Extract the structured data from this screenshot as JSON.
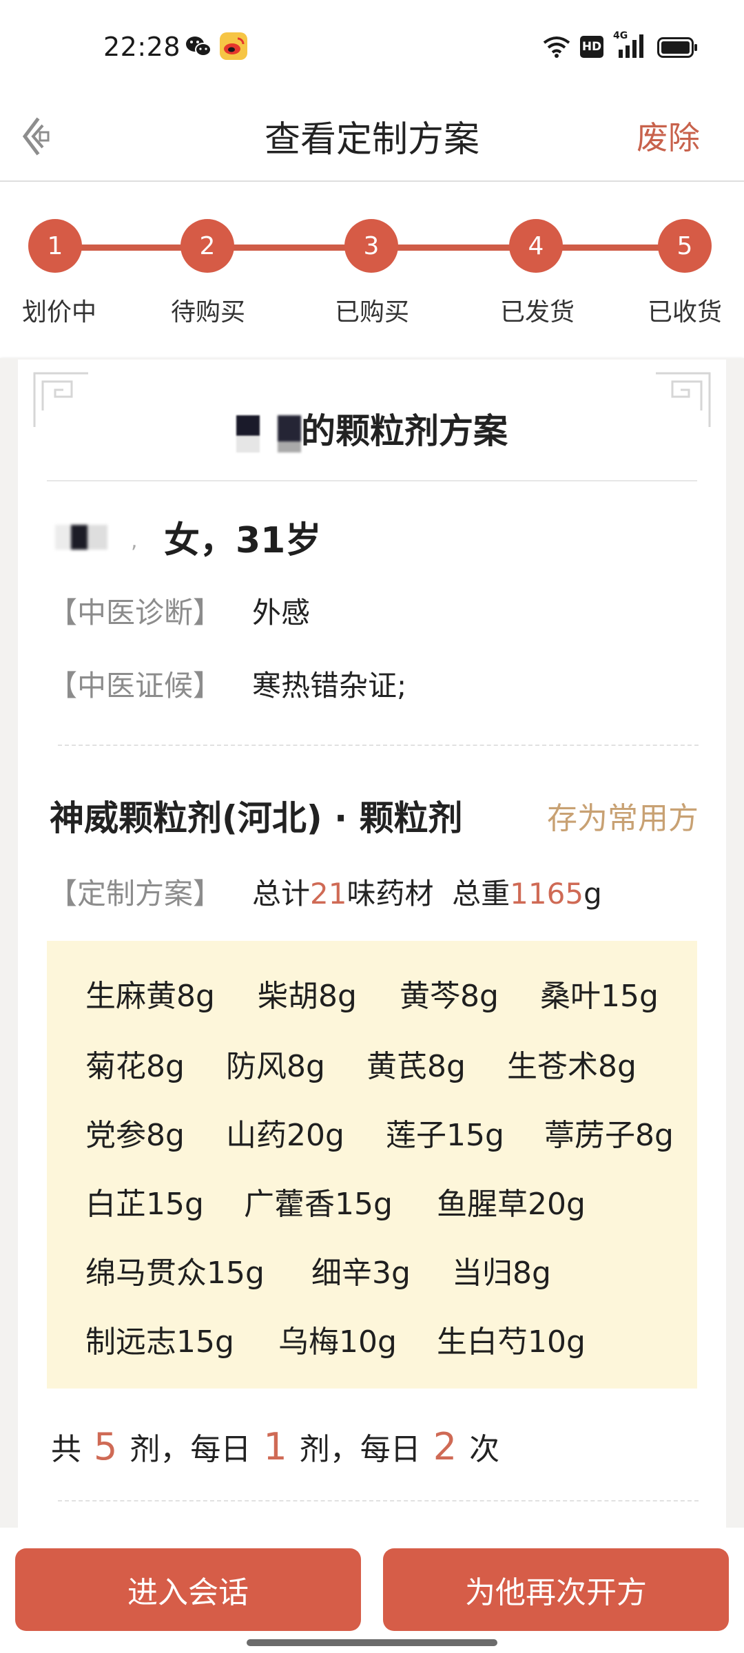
{
  "status_bar": {
    "time": "22:28",
    "left_icons": [
      "wechat-icon",
      "weibo-icon"
    ],
    "right_icons": [
      "alarm-icon",
      "wifi-icon",
      "hd-icon",
      "signal-4g-icon",
      "battery-icon"
    ],
    "network_label": "4G",
    "hd_label": "HD"
  },
  "nav": {
    "title": "查看定制方案",
    "action": "废除"
  },
  "progress": {
    "steps": [
      {
        "number": "1",
        "label": "划价中"
      },
      {
        "number": "2",
        "label": "待购买"
      },
      {
        "number": "3",
        "label": "已购买"
      },
      {
        "number": "4",
        "label": "已发货"
      },
      {
        "number": "5",
        "label": "已收货"
      }
    ]
  },
  "card": {
    "title_suffix": "的颗粒剂方案",
    "patient": {
      "info": "女，31岁"
    },
    "diagnosis_label": "【中医诊断】",
    "diagnosis_value": "外感",
    "syndrome_label": "【中医证候】",
    "syndrome_value": "寒热错杂证;",
    "formula_name": "神威颗粒剂(河北) · 颗粒剂",
    "save_favorite": "存为常用方",
    "plan_label": "【定制方案】",
    "plan_summary": {
      "prefix": "总计",
      "herb_count": "21",
      "middle": "味药材  总重",
      "total_weight": "1165",
      "unit": "g"
    },
    "herbs": [
      [
        "生麻黄8g",
        "柴胡8g",
        "黄芩8g",
        "桑叶15g"
      ],
      [
        "菊花8g",
        "防风8g",
        "黄芪8g",
        "生苍术8g"
      ],
      [
        "党参8g",
        "山药20g",
        "莲子15g",
        "葶苈子8g"
      ],
      [
        "白芷15g",
        "广藿香15g",
        "鱼腥草20g"
      ],
      [
        "绵马贯众15g",
        "细辛3g",
        "当归8g"
      ],
      [
        "制远志15g",
        "乌梅10g",
        "生白芍10g"
      ]
    ],
    "dosage": {
      "t1": "共",
      "doses": "5",
      "t2": "剂，每日",
      "per_day": "1",
      "t3": "剂，每日",
      "times": "2",
      "t4": "次"
    }
  },
  "buttons": {
    "chat": "进入会话",
    "represcribe": "为他再次开方"
  },
  "colors": {
    "accent": "#d65b46",
    "gold": "#c8a173",
    "herb_bg": "#fdf6da"
  }
}
